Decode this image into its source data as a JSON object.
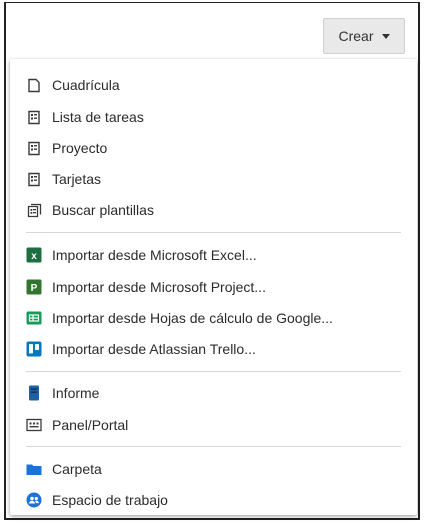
{
  "header": {
    "create_label": "Crear"
  },
  "menu": {
    "groups": [
      [
        {
          "label": "Cuadrícula",
          "icon": "grid-sheet-icon"
        },
        {
          "label": "Lista de tareas",
          "icon": "task-list-icon"
        },
        {
          "label": "Proyecto",
          "icon": "project-icon"
        },
        {
          "label": "Tarjetas",
          "icon": "cards-icon"
        },
        {
          "label": "Buscar plantillas",
          "icon": "templates-icon"
        }
      ],
      [
        {
          "label": "Importar desde Microsoft Excel...",
          "icon": "excel-icon"
        },
        {
          "label": "Importar desde Microsoft Project...",
          "icon": "ms-project-icon"
        },
        {
          "label": "Importar desde Hojas de cálculo de Google...",
          "icon": "google-sheets-icon"
        },
        {
          "label": "Importar desde Atlassian Trello...",
          "icon": "trello-icon"
        }
      ],
      [
        {
          "label": "Informe",
          "icon": "report-icon"
        },
        {
          "label": "Panel/Portal",
          "icon": "dashboard-icon"
        }
      ],
      [
        {
          "label": "Carpeta",
          "icon": "folder-icon"
        },
        {
          "label": "Espacio de trabajo",
          "icon": "workspace-icon"
        }
      ]
    ]
  },
  "colors": {
    "excel": "#1d6f42",
    "ms_project": "#31752f",
    "google_sheets": "#0f9d58",
    "trello": "#0079bf",
    "report": "#1f5fa8",
    "folder": "#1b73d3",
    "workspace": "#1b73d3"
  }
}
